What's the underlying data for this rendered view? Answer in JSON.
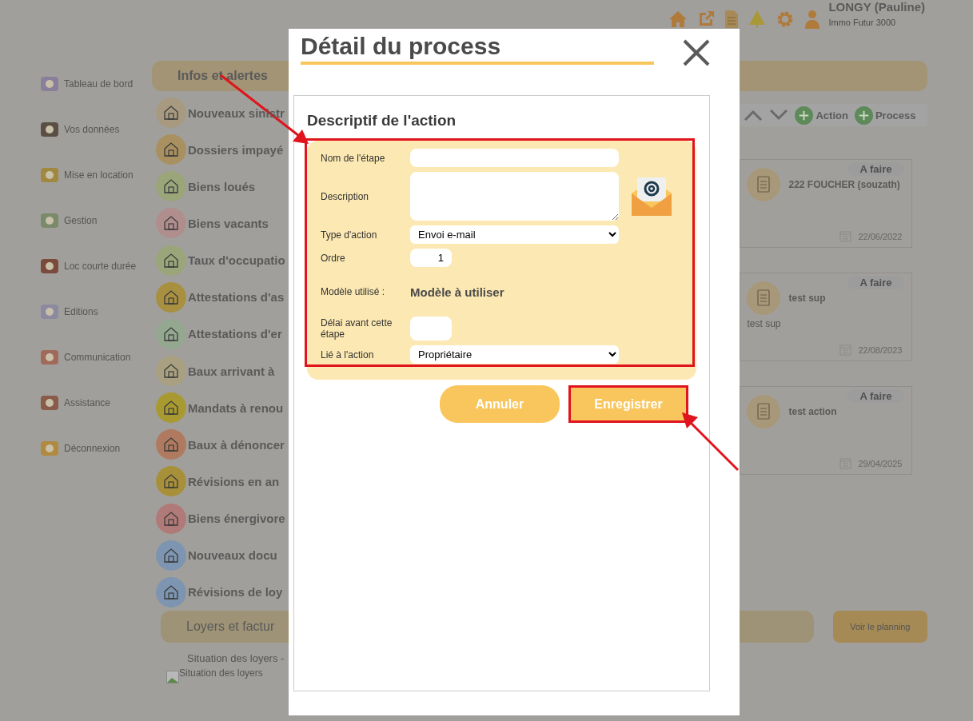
{
  "header": {
    "user_name": "LONGY (Pauline)",
    "company": "Immo Futur 3000"
  },
  "sidebar": {
    "items": [
      {
        "label": "Tableau de bord"
      },
      {
        "label": "Vos données"
      },
      {
        "label": "Mise en location"
      },
      {
        "label": "Gestion"
      },
      {
        "label": "Loc courte durée"
      },
      {
        "label": "Editions"
      },
      {
        "label": "Communication"
      },
      {
        "label": "Assistance"
      },
      {
        "label": "Déconnexion"
      }
    ]
  },
  "alerts": {
    "title": "Infos et alertes",
    "items": [
      {
        "label": "Nouveaux sinistr",
        "color": "#a89a80"
      },
      {
        "label": "Dossiers impayé",
        "color": "#a89060"
      },
      {
        "label": "Biens loués",
        "color": "#9aa57a"
      },
      {
        "label": "Biens vacants",
        "color": "#b08e8e"
      },
      {
        "label": "Taux d'occupatio",
        "color": "#9aa57a"
      },
      {
        "label": "Attestations d'as",
        "color": "#a89040"
      },
      {
        "label": "Attestations d'er",
        "color": "#94a890"
      },
      {
        "label": "Baux arrivant à",
        "color": "#a8a080"
      },
      {
        "label": "Mandats à renou",
        "color": "#a89a30"
      },
      {
        "label": "Baux à dénoncer",
        "color": "#b07a60"
      },
      {
        "label": "Révisions en an",
        "color": "#a8903a"
      },
      {
        "label": "Biens énergivore",
        "color": "#b07a78"
      },
      {
        "label": "Nouveaux docu",
        "color": "#7d95b0"
      },
      {
        "label": "Révisions de loy",
        "color": "#7d95b0"
      }
    ]
  },
  "toolbar": {
    "buttons": [
      "Action",
      "Process"
    ]
  },
  "tasks": [
    {
      "status": "A faire",
      "title": "222 FOUCHER (souzath)",
      "date": "22/06/2022"
    },
    {
      "status": "A faire",
      "title": "test sup",
      "note": "test sup",
      "date": "22/08/2023"
    },
    {
      "status": "A faire",
      "title": "test action",
      "date": "29/04/2025"
    }
  ],
  "rents": {
    "title": "Loyers et factur",
    "subtitle": "Situation des loyers -",
    "image_alt": "Situation des loyers",
    "planning_button": "Voir le planning"
  },
  "modal": {
    "title": "Détail du process",
    "section_title": "Descriptif de l'action",
    "highlighted": true,
    "fields": [
      {
        "kind": "text",
        "label": "Nom de l'étape"
      },
      {
        "kind": "textarea",
        "label": "Description"
      },
      {
        "kind": "select",
        "label": "Type d'action",
        "value": "Envoi e-mail"
      },
      {
        "kind": "number",
        "label": "Ordre",
        "value": "1"
      },
      {
        "kind": "static",
        "label": "Modèle utilisé :",
        "value": "Modèle à utiliser"
      },
      {
        "kind": "short",
        "label": "Délai avant cette étape"
      },
      {
        "kind": "select",
        "label": "Lié à l'action",
        "value": "Propriétaire"
      }
    ],
    "buttons": [
      {
        "label": "Annuler",
        "highlighted": false
      },
      {
        "label": "Enregistrer",
        "highlighted": true
      }
    ]
  }
}
